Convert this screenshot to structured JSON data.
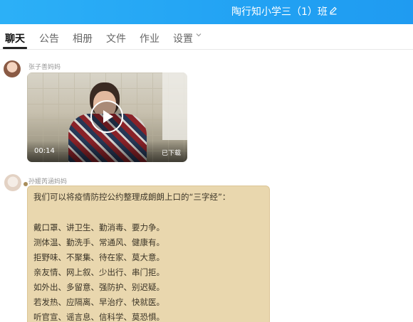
{
  "header": {
    "group_title": "陶行知小学三（1）班",
    "edit_icon": "edit-pencil-icon"
  },
  "tabs": [
    "聊天",
    "公告",
    "相册",
    "文件",
    "作业",
    "设置"
  ],
  "active_tab": "聊天",
  "messages": [
    {
      "sender": "张子善妈妈",
      "type": "video",
      "duration": "00:14",
      "status": "已下载"
    },
    {
      "sender": "孙媛芮涵妈妈",
      "type": "text",
      "lines": [
        "我们可以将疫情防控公约整理成朗朗上口的“三字经”：",
        "戴口罩、讲卫生、勤消毒、要力争。",
        "测体温、勤洗手、常通风、健康有。",
        "拒野味、不聚集、待在家、莫大意。",
        "亲友情、网上叙、少出行、串门拒。",
        "如外出、多留意、强防护、别迟疑。",
        "若发热、应隔离、早治疗、快就医。",
        "听官宣、谣言息、信科学、莫恐惧。"
      ]
    }
  ],
  "colors": {
    "header": "#22a2f3",
    "bubble": "#e9d7ae"
  }
}
